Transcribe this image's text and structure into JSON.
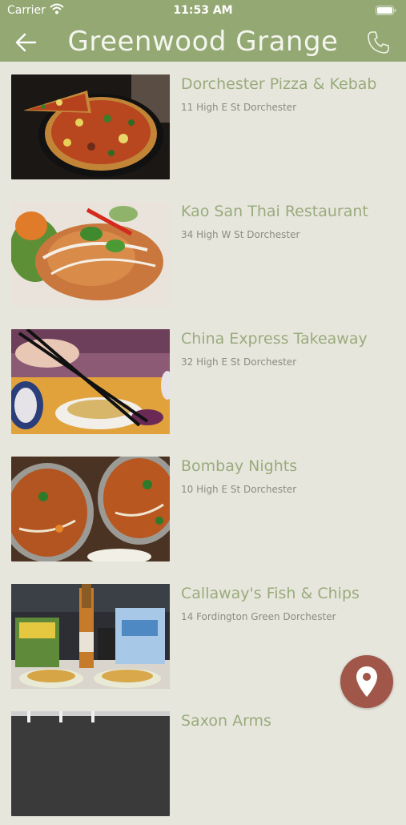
{
  "status_bar": {
    "carrier": "Carrier",
    "time": "11:53 AM"
  },
  "nav": {
    "title": "Greenwood Grange"
  },
  "places": [
    {
      "name": "Dorchester Pizza & Kebab",
      "address": "11 High E St Dorchester",
      "image": "pizza-photo"
    },
    {
      "name": "Kao San Thai Restaurant",
      "address": "34 High W St Dorchester",
      "image": "thai-food-photo"
    },
    {
      "name": "China Express Takeaway",
      "address": "32 High E St Dorchester",
      "image": "chinese-food-photo"
    },
    {
      "name": "Bombay Nights",
      "address": "10 High E St Dorchester",
      "image": "curry-photo"
    },
    {
      "name": "Callaway's Fish & Chips",
      "address": "14 Fordington Green Dorchester",
      "image": "fish-and-chips-photo"
    },
    {
      "name": "Saxon Arms",
      "address": "",
      "image": "pub-photo"
    }
  ],
  "colors": {
    "header": "#94a873",
    "background": "#e7e6dd",
    "title_text": "#99ab7c",
    "fab": "#a0574a"
  },
  "icons": {
    "back": "arrow-left-icon",
    "phone": "phone-icon",
    "map": "map-pin-icon"
  }
}
